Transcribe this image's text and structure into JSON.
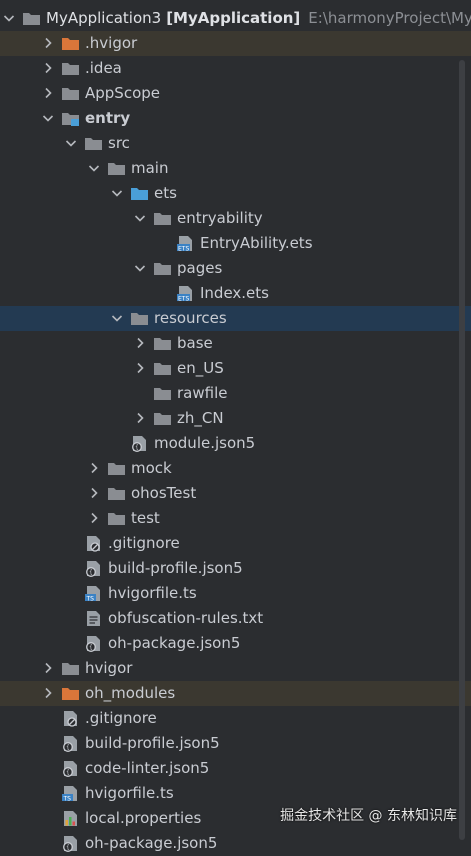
{
  "tree": [
    {
      "name": "MyApplication3",
      "bold": "[MyApplication]",
      "path": "E:\\harmonyProject\\MyA",
      "depth": 0,
      "chev": "down",
      "icon": "folder-gray",
      "root": true
    },
    {
      "name": ".hvigor",
      "depth": 1,
      "chev": "right",
      "icon": "folder-orange",
      "excluded": true
    },
    {
      "name": ".idea",
      "depth": 1,
      "chev": "right",
      "icon": "folder-gray"
    },
    {
      "name": "AppScope",
      "depth": 1,
      "chev": "right",
      "icon": "folder-gray"
    },
    {
      "name": "entry",
      "depth": 1,
      "chev": "down",
      "icon": "module",
      "boldName": true
    },
    {
      "name": "src",
      "depth": 2,
      "chev": "down",
      "icon": "folder-gray"
    },
    {
      "name": "main",
      "depth": 3,
      "chev": "down",
      "icon": "folder-gray"
    },
    {
      "name": "ets",
      "depth": 4,
      "chev": "down",
      "icon": "folder-blue"
    },
    {
      "name": "entryability",
      "depth": 5,
      "chev": "down",
      "icon": "folder-gray"
    },
    {
      "name": "EntryAbility.ets",
      "depth": 6,
      "chev": "none",
      "icon": "file-ets"
    },
    {
      "name": "pages",
      "depth": 5,
      "chev": "down",
      "icon": "folder-gray"
    },
    {
      "name": "Index.ets",
      "depth": 6,
      "chev": "none",
      "icon": "file-ets"
    },
    {
      "name": "resources",
      "depth": 4,
      "chev": "down",
      "icon": "folder-gray",
      "selected": true
    },
    {
      "name": "base",
      "depth": 5,
      "chev": "right",
      "icon": "folder-gray"
    },
    {
      "name": "en_US",
      "depth": 5,
      "chev": "right",
      "icon": "folder-gray"
    },
    {
      "name": "rawfile",
      "depth": 5,
      "chev": "none",
      "icon": "folder-gray"
    },
    {
      "name": "zh_CN",
      "depth": 5,
      "chev": "right",
      "icon": "folder-gray"
    },
    {
      "name": "module.json5",
      "depth": 4,
      "chev": "none",
      "icon": "file-json"
    },
    {
      "name": "mock",
      "depth": 3,
      "chev": "right",
      "icon": "folder-gray"
    },
    {
      "name": "ohosTest",
      "depth": 3,
      "chev": "right",
      "icon": "folder-gray"
    },
    {
      "name": "test",
      "depth": 3,
      "chev": "right",
      "icon": "folder-gray"
    },
    {
      "name": ".gitignore",
      "depth": 2,
      "chev": "none",
      "icon": "file-ignore"
    },
    {
      "name": "build-profile.json5",
      "depth": 2,
      "chev": "none",
      "icon": "file-json"
    },
    {
      "name": "hvigorfile.ts",
      "depth": 2,
      "chev": "none",
      "icon": "file-ts"
    },
    {
      "name": "obfuscation-rules.txt",
      "depth": 2,
      "chev": "none",
      "icon": "file-text"
    },
    {
      "name": "oh-package.json5",
      "depth": 2,
      "chev": "none",
      "icon": "file-json"
    },
    {
      "name": "hvigor",
      "depth": 1,
      "chev": "right",
      "icon": "folder-gray"
    },
    {
      "name": "oh_modules",
      "depth": 1,
      "chev": "right",
      "icon": "folder-orange",
      "excluded": true
    },
    {
      "name": ".gitignore",
      "depth": 1,
      "chev": "none",
      "icon": "file-ignore"
    },
    {
      "name": "build-profile.json5",
      "depth": 1,
      "chev": "none",
      "icon": "file-json"
    },
    {
      "name": "code-linter.json5",
      "depth": 1,
      "chev": "none",
      "icon": "file-json"
    },
    {
      "name": "hvigorfile.ts",
      "depth": 1,
      "chev": "none",
      "icon": "file-ts"
    },
    {
      "name": "local.properties",
      "depth": 1,
      "chev": "none",
      "icon": "file-properties"
    },
    {
      "name": "oh-package.json5",
      "depth": 1,
      "chev": "none",
      "icon": "file-json"
    }
  ],
  "watermark": "掘金技术社区 @ 东林知识库",
  "colors": {
    "background": "#2b2d30",
    "selected_row": "#233a52",
    "excluded_row": "#3b3830",
    "folder_gray": "#8a8d92",
    "folder_orange": "#d9763a",
    "folder_blue": "#4a9fd8",
    "ts_badge": "#3b82c4"
  }
}
